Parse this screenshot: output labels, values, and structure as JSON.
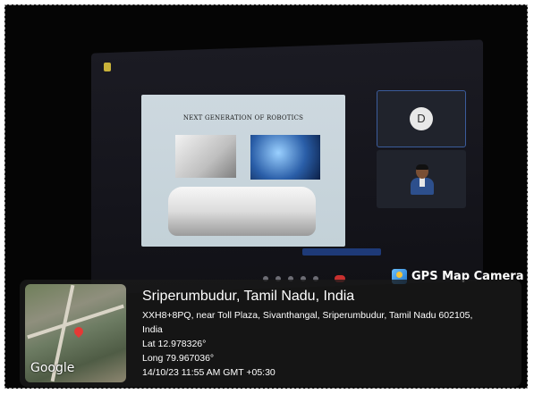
{
  "meeting": {
    "slide_title": "NEXT GENERATION OF ROBOTICS"
  },
  "participants": [
    {
      "initial": "D"
    }
  ],
  "overlay": {
    "app_label": "GPS Map Camera",
    "map_brand": "Google",
    "location_title": "Sriperumbudur, Tamil Nadu, India",
    "address_line1": "XXH8+8PQ, near Toll Plaza, Sivanthangal, Sriperumbudur, Tamil Nadu 602105,",
    "address_line2": "India",
    "latitude": "Lat 12.978326°",
    "longitude": "Long 79.967036°",
    "datetime": "14/10/23 11:55 AM GMT +05:30"
  },
  "colors": {
    "end_call": "#c8302f",
    "map_pin": "#e53935"
  },
  "icons": [
    "gps-map-camera-icon",
    "map-pin-icon",
    "end-call-icon"
  ]
}
